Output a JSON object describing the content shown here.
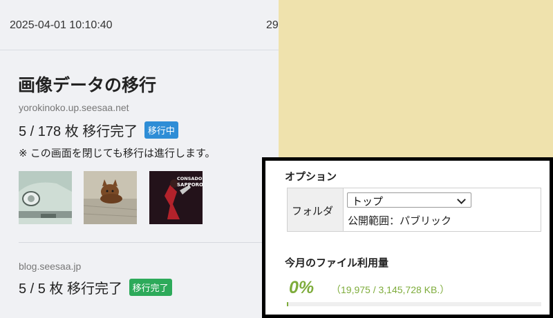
{
  "header": {
    "timestamp": "2025-04-01 10:10:40",
    "count_fragment": "29"
  },
  "migration": {
    "title": "画像データの移行",
    "note": "※ この画面を閉じても移行は進行します。",
    "sites": [
      {
        "domain": "yorokinoko.up.seesaa.net",
        "count": "5 / 178 枚 移行完了",
        "status": "移行中",
        "status_color": "#2e8dd6"
      },
      {
        "domain": "blog.seesaa.jp",
        "count": "5 / 5 枚 移行完了",
        "status": "移行完了",
        "status_color": "#2daa5a"
      }
    ],
    "thumbnails": [
      {
        "alt_icon": "car-photo"
      },
      {
        "alt_icon": "cat-photo"
      },
      {
        "alt_icon": "poster-photo",
        "text_lines": [
          "CONSADOLE",
          "SAPPORO"
        ]
      }
    ]
  },
  "options": {
    "heading": "オプション",
    "folder_label": "フォルダ",
    "folder_value": "トップ",
    "visibility": "公開範囲：パブリック",
    "usage_heading": "今月のファイル利用量",
    "usage_percent": "0%",
    "usage_detail": "（19,975 / 3,145,728 KB.）",
    "usage_fraction": 0.006,
    "accent_color": "#7eac3b"
  }
}
